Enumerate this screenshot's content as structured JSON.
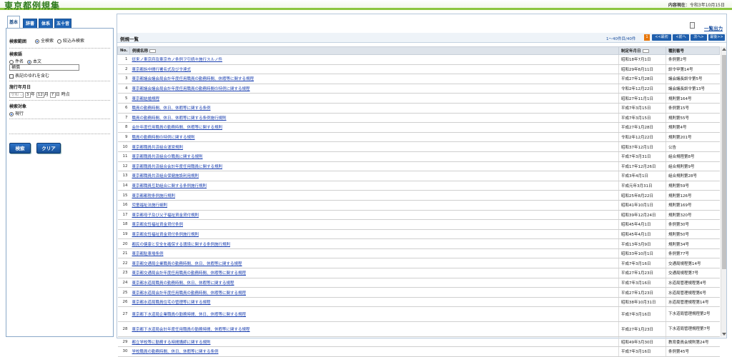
{
  "header": {
    "title": "東京都例規集",
    "update_label": "内容現在",
    "update_date": "令和3年10月15日"
  },
  "sidebar": {
    "tabs": [
      {
        "label": "基本"
      },
      {
        "label": "辞書"
      },
      {
        "label": "体系"
      },
      {
        "label": "五十音"
      }
    ],
    "search_scope": {
      "label": "検索範囲",
      "opt_all": "全検索",
      "opt_refine": "絞込み検索"
    },
    "search_term": {
      "label": "検索語",
      "opt_title": "件名",
      "opt_body": "本文",
      "value": "補償",
      "variant_label": "表記のゆれを含む"
    },
    "effective_date": {
      "label": "施行年月日",
      "era": "令和",
      "year": "3",
      "year_unit": "年",
      "month": "12",
      "month_unit": "月",
      "day": "7",
      "day_unit": "日",
      "suffix": "時点"
    },
    "search_target": {
      "label": "検索対象",
      "opt_current": "現行"
    },
    "buttons": {
      "search": "検索",
      "clear": "クリア"
    }
  },
  "main": {
    "title": "例規一覧",
    "export_label": "一覧出力",
    "count": "1〜40件目/40件",
    "page": "1",
    "pager": {
      "first": "<<最初",
      "prev": "<前へ",
      "next": "次へ>",
      "last": "最後>>"
    },
    "columns": {
      "no": "No.",
      "name": "例規名称",
      "date": "制定年月日",
      "type": "種別番号"
    },
    "rows": [
      {
        "no": "1",
        "name": "従来ノ東京府及東京市ノ条例ヲ引続キ施行スルノ件",
        "date": "昭和18年7月1日",
        "type": "条例第2号"
      },
      {
        "no": "2",
        "name": "東京都訴中間行署名式及び令達式",
        "date": "昭和29年8月11日",
        "type": "訓令甲第14号"
      },
      {
        "no": "3",
        "name": "東京都議会議会局会計年度任用職員の勤務時間、休暇等に関する規程",
        "date": "平成27年1月28日",
        "type": "議会議長訓令第5号"
      },
      {
        "no": "4",
        "name": "東京都議会議会局会計年度任用職員の勤務時間の特例に関する規程",
        "date": "令和2年12月22日",
        "type": "議会議長訓令第13号"
      },
      {
        "no": "5",
        "name": "東京都結婚規程",
        "date": "昭和27年11月1日",
        "type": "規則第164号"
      },
      {
        "no": "6",
        "name": "職員の勤務時間、休日、休暇等に関する条例",
        "date": "平成7年3月15日",
        "type": "条例第15号"
      },
      {
        "no": "7",
        "name": "職員の勤務時間、休日、休暇等に関する条例施行規則",
        "date": "平成7年3月15日",
        "type": "規則第55号"
      },
      {
        "no": "8",
        "name": "会計年度任用職員の勤務時間、休暇等に関する規則",
        "date": "平成27年1月28日",
        "type": "規則第4号"
      },
      {
        "no": "9",
        "name": "職員の勤務時間の特例に関する規則",
        "date": "令和2年12月22日",
        "type": "規則第201号"
      },
      {
        "no": "10",
        "name": "東京都職員共済組合運営規則",
        "date": "昭和37年12月1日",
        "type": "公告"
      },
      {
        "no": "11",
        "name": "東京都職員共済組合の職員に関する規則",
        "date": "平成7年3月31日",
        "type": "組合規程第8号"
      },
      {
        "no": "12",
        "name": "東京都職員共済組合会計年度任用職員に関する規則",
        "date": "平成17年12月26日",
        "type": "組合規則第9号"
      },
      {
        "no": "13",
        "name": "東京都職員共済組合保健施設利用規則",
        "date": "平成3年4月1日",
        "type": "組合規則第28号"
      },
      {
        "no": "14",
        "name": "東京都職員互助組合に関する条例施行規則",
        "date": "平成元年3月31日",
        "type": "規則第59号"
      },
      {
        "no": "15",
        "name": "東京都都税条例施行規則",
        "date": "昭和25年8月22日",
        "type": "規則第126号"
      },
      {
        "no": "16",
        "name": "児童福祉法施行細則",
        "date": "昭和41年10月1日",
        "type": "規則第169号"
      },
      {
        "no": "17",
        "name": "東京都母子及び父子福祉資金貸付規則",
        "date": "昭和39年12月24日",
        "type": "規則第320号"
      },
      {
        "no": "18",
        "name": "東京都女性福祉資金貸付条例",
        "date": "昭和45年4月1日",
        "type": "条例第30号"
      },
      {
        "no": "19",
        "name": "東京都女性福祉資金貸付条例施行規則",
        "date": "昭和45年4月1日",
        "type": "規則第50号"
      },
      {
        "no": "20",
        "name": "都民の健康と安全を確保する環境に関する条例施行規則",
        "date": "平成13年3月9日",
        "type": "規則第34号"
      },
      {
        "no": "21",
        "name": "東京都駐車場条例",
        "date": "昭和33年10月1日",
        "type": "条例第77号"
      },
      {
        "no": "22",
        "name": "東京都交通局企業職員の勤務時間、休日、休暇等に関する規程",
        "date": "平成7年3月16日",
        "type": "交通局規程第14号"
      },
      {
        "no": "23",
        "name": "東京都交通局会計年度任用職員の勤務時間、休暇等に関する規程",
        "date": "平成27年1月23日",
        "type": "交通局規程第7号"
      },
      {
        "no": "24",
        "name": "東京都水道局職員の勤務時間、休日、休暇等に関する規程",
        "date": "平成7年3月16日",
        "type": "水道局管理規程第4号"
      },
      {
        "no": "25",
        "name": "東京都水道局会計年度任用職員の勤務時間、休暇等に関する規程",
        "date": "平成27年1月23日",
        "type": "水道局管理規程第6号"
      },
      {
        "no": "26",
        "name": "東京都水道局職員住宅の管理等に関する規程",
        "date": "昭和38年10月31日",
        "type": "水道局管理規程第14号"
      },
      {
        "no": "27",
        "name": "東京都下水道局企業職員の勤務時間、休日、休暇等に関する規程",
        "date": "平成7年3月16日",
        "type": "下水道局管理規程第2号"
      },
      {
        "no": "28",
        "name": "東京都下水道局会計年度任用職員の勤務時間、休暇等に関する規程",
        "date": "平成27年1月23日",
        "type": "下水道局管理規程第7号"
      },
      {
        "no": "29",
        "name": "都立学校等に勤務する時間講師に関する規則",
        "date": "昭和49年3月30日",
        "type": "教育委員会規則第24号"
      },
      {
        "no": "30",
        "name": "学校職員の勤務時間、休日、休暇等に関する条例",
        "date": "平成7年3月16日",
        "type": "条例第45号"
      }
    ]
  },
  "colors": {
    "title_green": "#2f7a1e",
    "accent_green": "#8cc63f",
    "tab_blue": "#1f64b5",
    "link_blue": "#1a3fb0",
    "page_orange": "#e8780c"
  }
}
